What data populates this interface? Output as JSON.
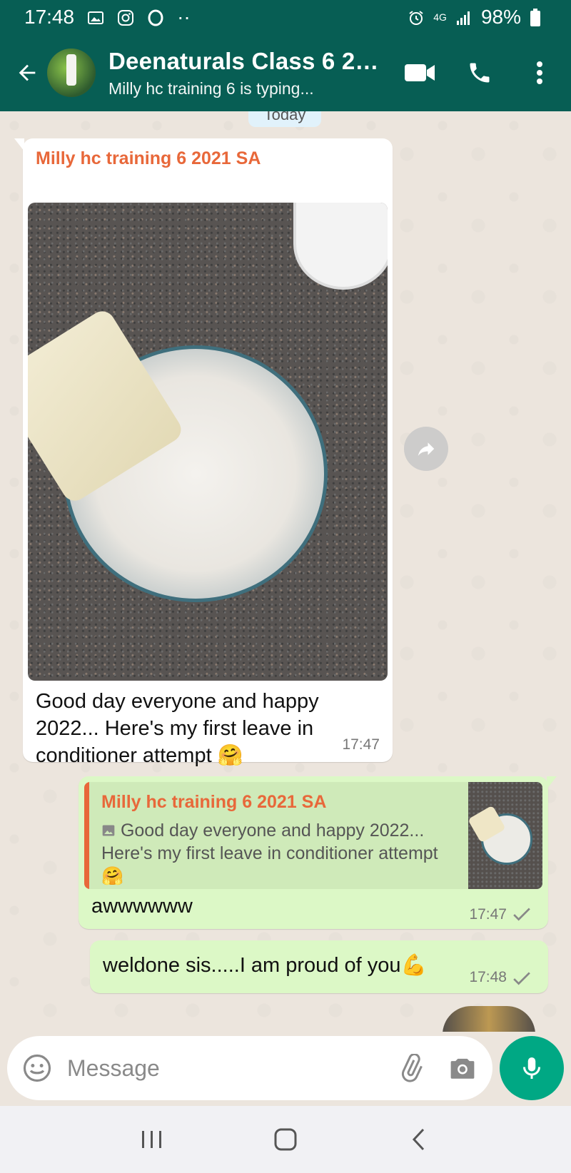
{
  "status_bar": {
    "time": "17:48",
    "network": "4G",
    "battery": "98%",
    "dots": "··"
  },
  "header": {
    "title": "Deenaturals Class 6 20...",
    "subtitle": "Milly hc training 6 is typing...",
    "icons": [
      "arrow-left-icon",
      "video-call-icon",
      "phone-icon",
      "more-vert-icon"
    ]
  },
  "chat": {
    "date_chip": "Today",
    "incoming": {
      "sender": "Milly hc training 6 2021 SA",
      "text": "Good day everyone and happy 2022... Here's my first leave in conditioner attempt 🤗",
      "time": "17:47"
    },
    "outgoing": [
      {
        "quoted_sender": "Milly hc training 6 2021 SA",
        "quoted_text": "Good day everyone and happy 2022... Here's my first leave in conditioner attempt 🤗",
        "text": "awwwwww",
        "time": "17:47"
      },
      {
        "text": "weldone sis.....I am proud of you💪",
        "time": "17:48"
      }
    ]
  },
  "composer": {
    "placeholder": "Message"
  },
  "colors": {
    "header_bg": "#075e54",
    "outgoing_bubble": "#dcf8c6",
    "sender_name": "#e8683a",
    "mic_button": "#00a884"
  }
}
